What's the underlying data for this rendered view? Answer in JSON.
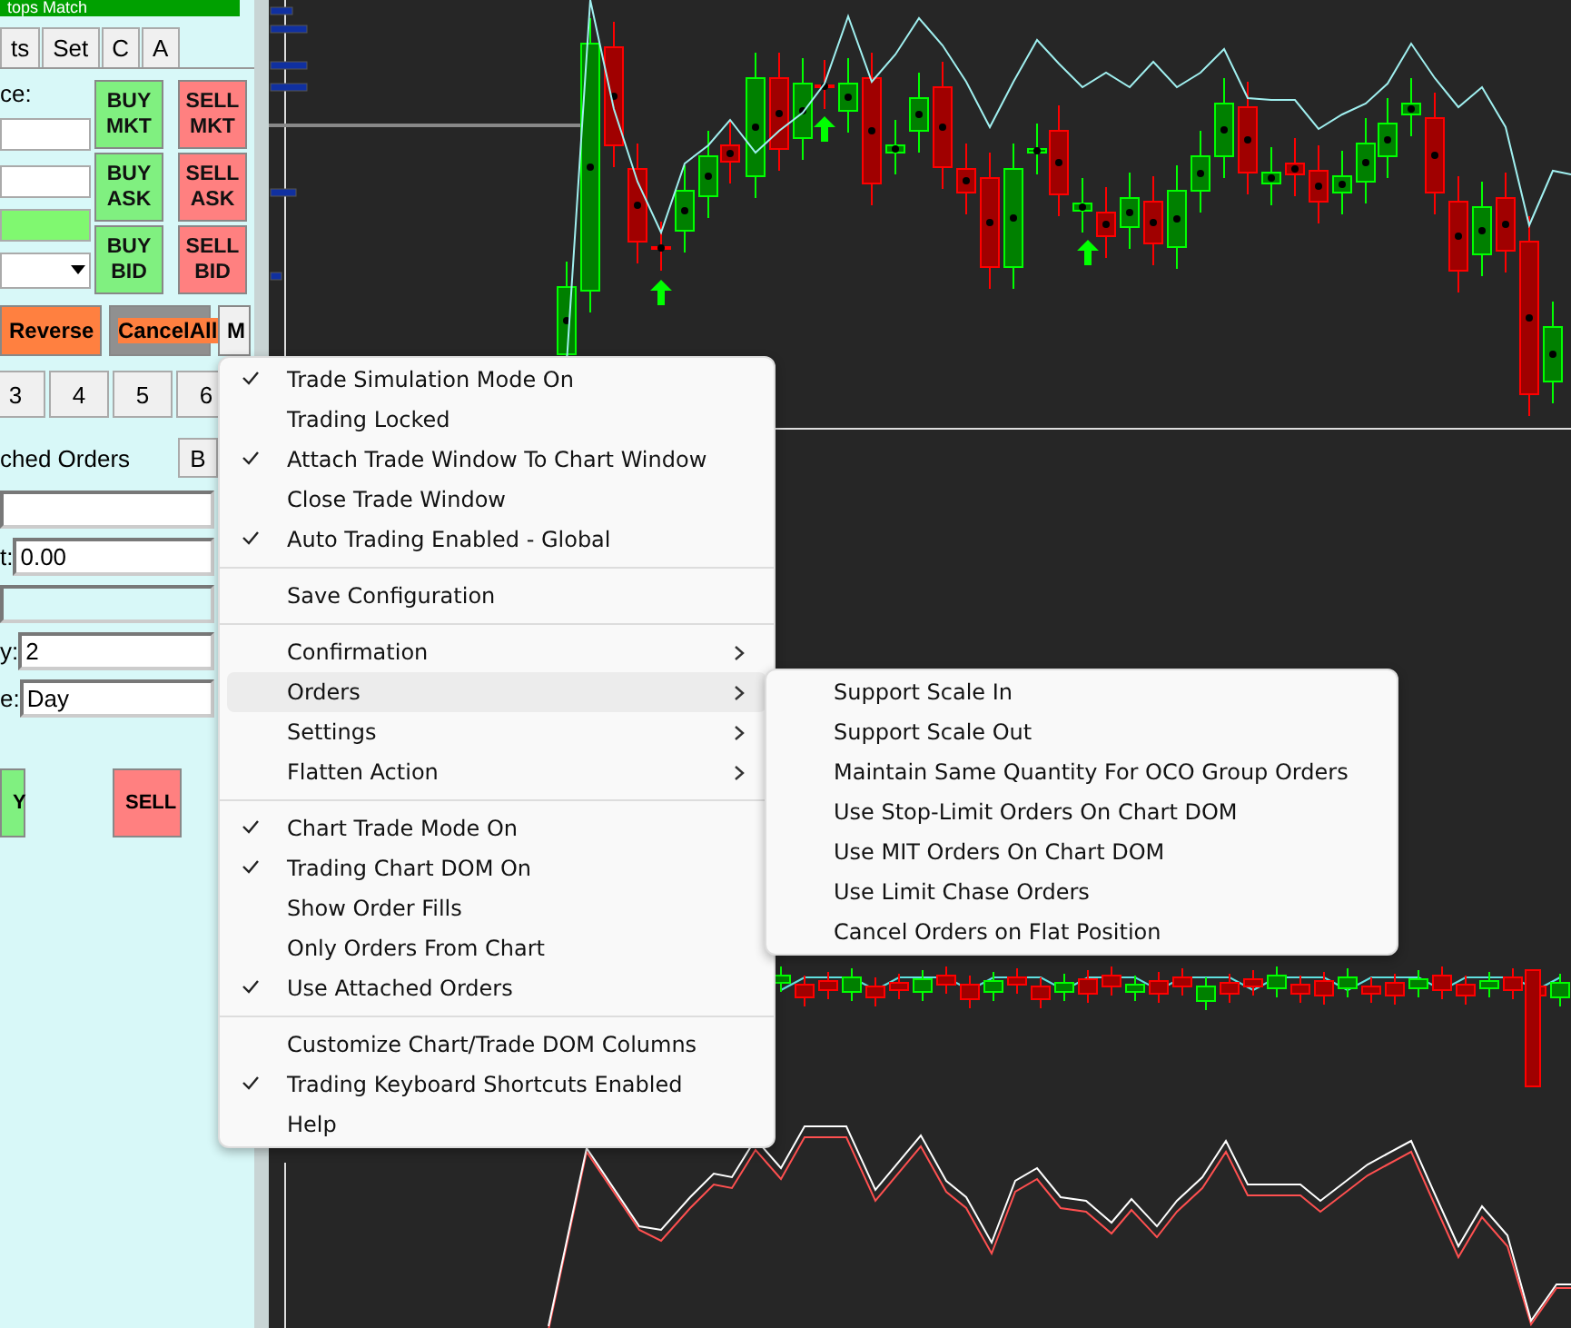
{
  "header_bar": {
    "text": "tops Match"
  },
  "tabs": [
    {
      "label": "ts",
      "selected": false
    },
    {
      "label": "Set",
      "selected": false
    },
    {
      "label": "C",
      "selected": false
    },
    {
      "label": "A",
      "selected": false
    }
  ],
  "price_label": "ce:",
  "order_buttons": [
    {
      "label": "BUY MKT",
      "kind": "buy"
    },
    {
      "label": "SELL MKT",
      "kind": "sell"
    },
    {
      "label": "BUY ASK",
      "kind": "buy"
    },
    {
      "label": "SELL ASK",
      "kind": "sell"
    },
    {
      "label": "BUY BID",
      "kind": "buy"
    },
    {
      "label": "SELL BID",
      "kind": "sell"
    }
  ],
  "action_buttons": [
    {
      "label": "Reverse",
      "kind": "orange"
    },
    {
      "label": "CancelAll",
      "kind": "cancel"
    },
    {
      "label": "M",
      "kind": "plain"
    }
  ],
  "number_buttons": [
    "3",
    "4",
    "5",
    "6"
  ],
  "attached_orders_label": "ched Orders",
  "attached_orders_button": "B",
  "fields": [
    {
      "disabled": false
    },
    {
      "label": "t:",
      "value": "0.00",
      "disabled": false
    },
    {
      "disabled": true
    },
    {
      "label": "y:",
      "value": "2",
      "disabled": false
    },
    {
      "label": "e:",
      "value": "Day",
      "disabled": false
    }
  ],
  "trade_buttons": [
    {
      "label": "Y",
      "kind": "buy"
    },
    {
      "label": "SELL",
      "kind": "sell"
    }
  ],
  "context_menu": {
    "groups": [
      [
        {
          "label": "Trade Simulation Mode On",
          "checked": true,
          "submenu": false,
          "selected": false
        },
        {
          "label": "Trading Locked",
          "checked": false,
          "submenu": false,
          "selected": false
        },
        {
          "label": "Attach Trade Window To Chart Window",
          "checked": true,
          "submenu": false,
          "selected": false
        },
        {
          "label": "Close Trade Window",
          "checked": false,
          "submenu": false,
          "selected": false
        },
        {
          "label": "Auto Trading Enabled - Global",
          "checked": true,
          "submenu": false,
          "selected": false
        }
      ],
      [
        {
          "label": "Save Configuration",
          "checked": false,
          "submenu": false,
          "selected": false
        }
      ],
      [
        {
          "label": "Confirmation",
          "checked": false,
          "submenu": true,
          "selected": false
        },
        {
          "label": "Orders",
          "checked": false,
          "submenu": true,
          "selected": true
        },
        {
          "label": "Settings",
          "checked": false,
          "submenu": true,
          "selected": false
        },
        {
          "label": "Flatten Action",
          "checked": false,
          "submenu": true,
          "selected": false
        }
      ],
      [
        {
          "label": "Chart Trade Mode On",
          "checked": true,
          "submenu": false,
          "selected": false
        },
        {
          "label": "Trading Chart DOM On",
          "checked": true,
          "submenu": false,
          "selected": false
        },
        {
          "label": "Show Order Fills",
          "checked": false,
          "submenu": false,
          "selected": false
        },
        {
          "label": "Only Orders From Chart",
          "checked": false,
          "submenu": false,
          "selected": false
        },
        {
          "label": "Use Attached Orders",
          "checked": true,
          "submenu": false,
          "selected": false
        }
      ],
      [
        {
          "label": "Customize Chart/Trade DOM Columns",
          "checked": false,
          "submenu": false,
          "selected": false
        },
        {
          "label": "Trading Keyboard Shortcuts Enabled",
          "checked": true,
          "submenu": false,
          "selected": false
        },
        {
          "label": "Help",
          "checked": false,
          "submenu": false,
          "selected": false
        }
      ]
    ]
  },
  "submenu": {
    "items": [
      {
        "label": "Support Scale In",
        "checked": false
      },
      {
        "label": "Support Scale Out",
        "checked": false
      },
      {
        "label": "Maintain Same Quantity For OCO Group Orders",
        "checked": false
      },
      {
        "label": "Use Stop-Limit Orders On Chart DOM",
        "checked": false
      },
      {
        "label": "Use MIT Orders On Chart DOM",
        "checked": false
      },
      {
        "label": "Use Limit Chase Orders",
        "checked": false
      },
      {
        "label": "Cancel Orders on Flat Position",
        "checked": false
      }
    ]
  }
}
